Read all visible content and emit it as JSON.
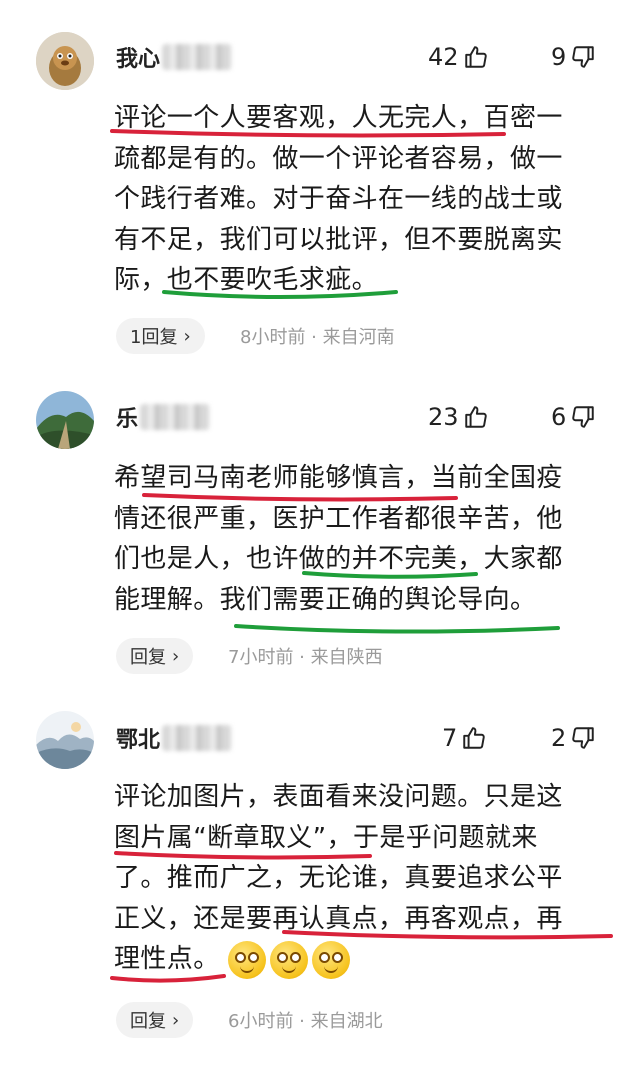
{
  "comments": [
    {
      "username": "我心",
      "likes": "42",
      "dislikes": "9",
      "lines": [
        "评论一个人要客观，人无完人，百密一",
        "疏都是有的。做一个评论者容易，做一",
        "个践行者难。对于奋斗在一线的战士或",
        "有不足，我们可以批评，但不要脱离实",
        "际，也不要吹毛求疵。"
      ],
      "reply_label": "1回复",
      "meta": "8小时前 · 来自河南"
    },
    {
      "username": "乐",
      "likes": "23",
      "dislikes": "6",
      "lines": [
        "希望司马南老师能够慎言，当前全国疫",
        "情还很严重，医护工作者都很辛苦，他",
        "们也是人，也许做的并不完美，大家都",
        "能理解。我们需要正确的舆论导向。"
      ],
      "reply_label": "回复",
      "meta": "7小时前 · 来自陕西"
    },
    {
      "username": "鄂北",
      "likes": "7",
      "dislikes": "2",
      "lines": [
        "评论加图片，表面看来没问题。只是这",
        "图片属“断章取义”，于是乎问题就来",
        "了。推而广之，无论谁，真要追求公平",
        "正义，还是要再认真点，再客观点，再",
        "理性点。"
      ],
      "reply_label": "回复",
      "meta": "6小时前 · 来自湖北"
    }
  ],
  "colors": {
    "red_underline": "#d8223a",
    "green_underline": "#1f9e3a"
  }
}
